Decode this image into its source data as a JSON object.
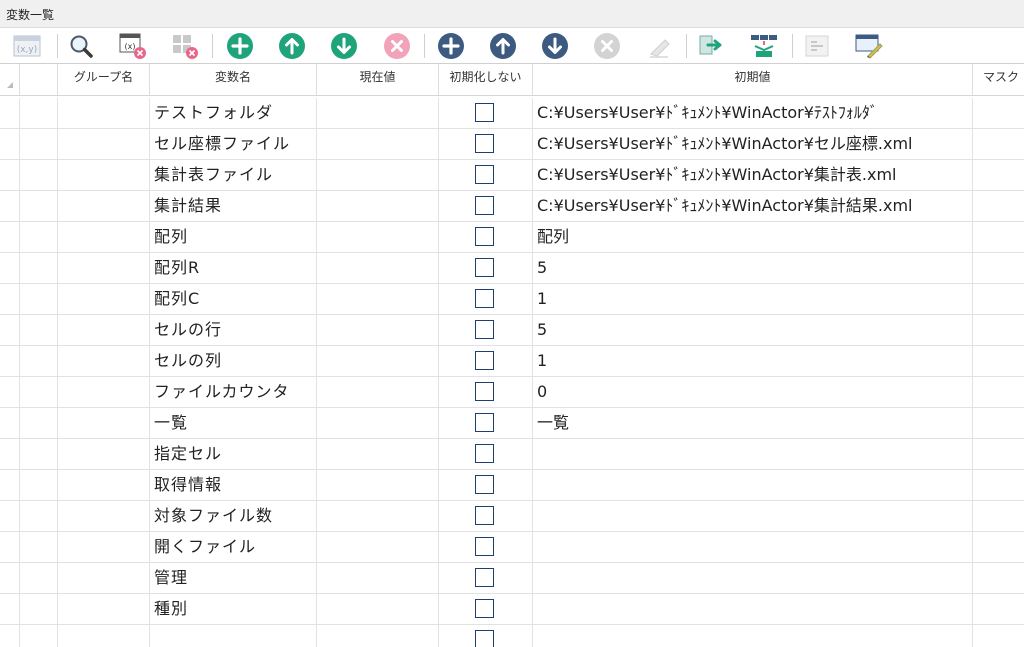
{
  "window": {
    "title": "変数一覧"
  },
  "colors": {
    "accent_green": "#1fa37a",
    "accent_navy": "#3d5a80",
    "disabled": "#c8c8c8",
    "delete_red": "#e8668a"
  },
  "toolbar": {
    "icons": [
      "xy-icon",
      "search-icon",
      "clear-variable-icon",
      "clear-grid-icon",
      "add-green-icon",
      "up-green-icon",
      "down-green-icon",
      "delete-red-icon",
      "add-navy-icon",
      "up-navy-icon",
      "down-navy-icon",
      "delete-gray-icon",
      "eraser-icon",
      "export-icon",
      "structure-icon",
      "indent-icon",
      "edit-icon"
    ]
  },
  "table": {
    "headers": {
      "group": "グループ名",
      "name": "変数名",
      "current": "現在値",
      "noinit": "初期化しない",
      "initial": "初期値",
      "mask": "マスク"
    },
    "rows": [
      {
        "name": "テストフォルダ",
        "initial": "C:¥Users¥User¥ﾄﾞｷｭﾒﾝﾄ¥WinActor¥ﾃｽﾄﾌｫﾙﾀﾞ"
      },
      {
        "name": "セル座標ファイル",
        "initial": "C:¥Users¥User¥ﾄﾞｷｭﾒﾝﾄ¥WinActor¥セル座標.xml"
      },
      {
        "name": "集計表ファイル",
        "initial": "C:¥Users¥User¥ﾄﾞｷｭﾒﾝﾄ¥WinActor¥集計表.xml"
      },
      {
        "name": "集計結果",
        "initial": "C:¥Users¥User¥ﾄﾞｷｭﾒﾝﾄ¥WinActor¥集計結果.xml"
      },
      {
        "name": "配列",
        "initial": "配列"
      },
      {
        "name": "配列R",
        "initial": "5"
      },
      {
        "name": "配列C",
        "initial": "1"
      },
      {
        "name": "セルの行",
        "initial": "5"
      },
      {
        "name": "セルの列",
        "initial": "1"
      },
      {
        "name": "ファイルカウンタ",
        "initial": "0"
      },
      {
        "name": "一覧",
        "initial": "一覧"
      },
      {
        "name": "指定セル",
        "initial": ""
      },
      {
        "name": "取得情報",
        "initial": ""
      },
      {
        "name": "対象ファイル数",
        "initial": ""
      },
      {
        "name": "開くファイル",
        "initial": ""
      },
      {
        "name": "管理",
        "initial": ""
      },
      {
        "name": "種別",
        "initial": ""
      },
      {
        "name": "",
        "initial": ""
      }
    ]
  }
}
